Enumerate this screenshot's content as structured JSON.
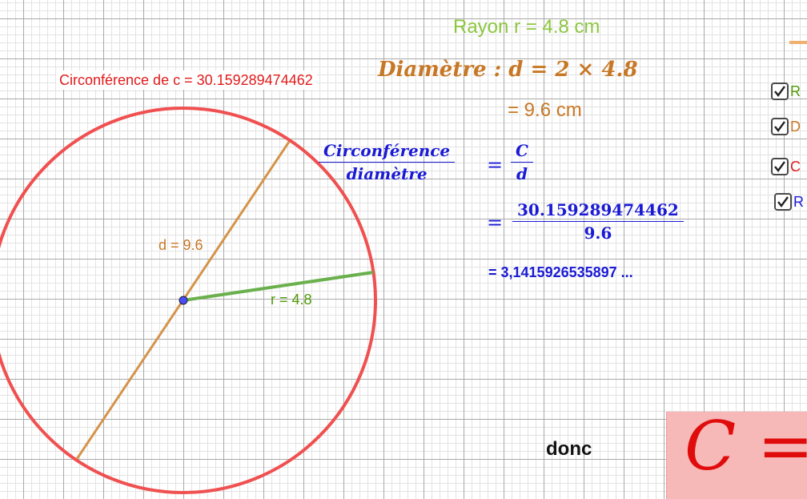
{
  "circumference_label": "Circonférence de c = 30.159289474462",
  "rayon_line": "Rayon r = 4.8 cm",
  "diametre_line": "Diamètre : d = 2 ×  4.8",
  "diametre_result": "= 9.6 cm",
  "fraction_1": {
    "numerator": "Circonférence",
    "denominator": "diamètre"
  },
  "fraction_2": {
    "numerator": "C",
    "denominator": "d"
  },
  "fraction_3": {
    "numerator": "30.159289474462",
    "denominator": "9.6"
  },
  "equals_sign": "=",
  "pi_value": "=  3,1415926535897 ...",
  "segment_labels": {
    "diameter": "d = 9.6",
    "radius": "r = 4.8"
  },
  "donc": "donc",
  "formula_partial": "C =",
  "checkboxes": [
    {
      "label": "R",
      "checked": true
    },
    {
      "label": "D",
      "checked": true
    },
    {
      "label": "C",
      "checked": true
    },
    {
      "label": "R",
      "checked": true
    }
  ],
  "colors": {
    "circle": "#f05050",
    "diameter": "#d4944a",
    "radius": "#6ab04c",
    "center_point": "#4a4aff",
    "formula_bg": "#f7b8b8"
  }
}
